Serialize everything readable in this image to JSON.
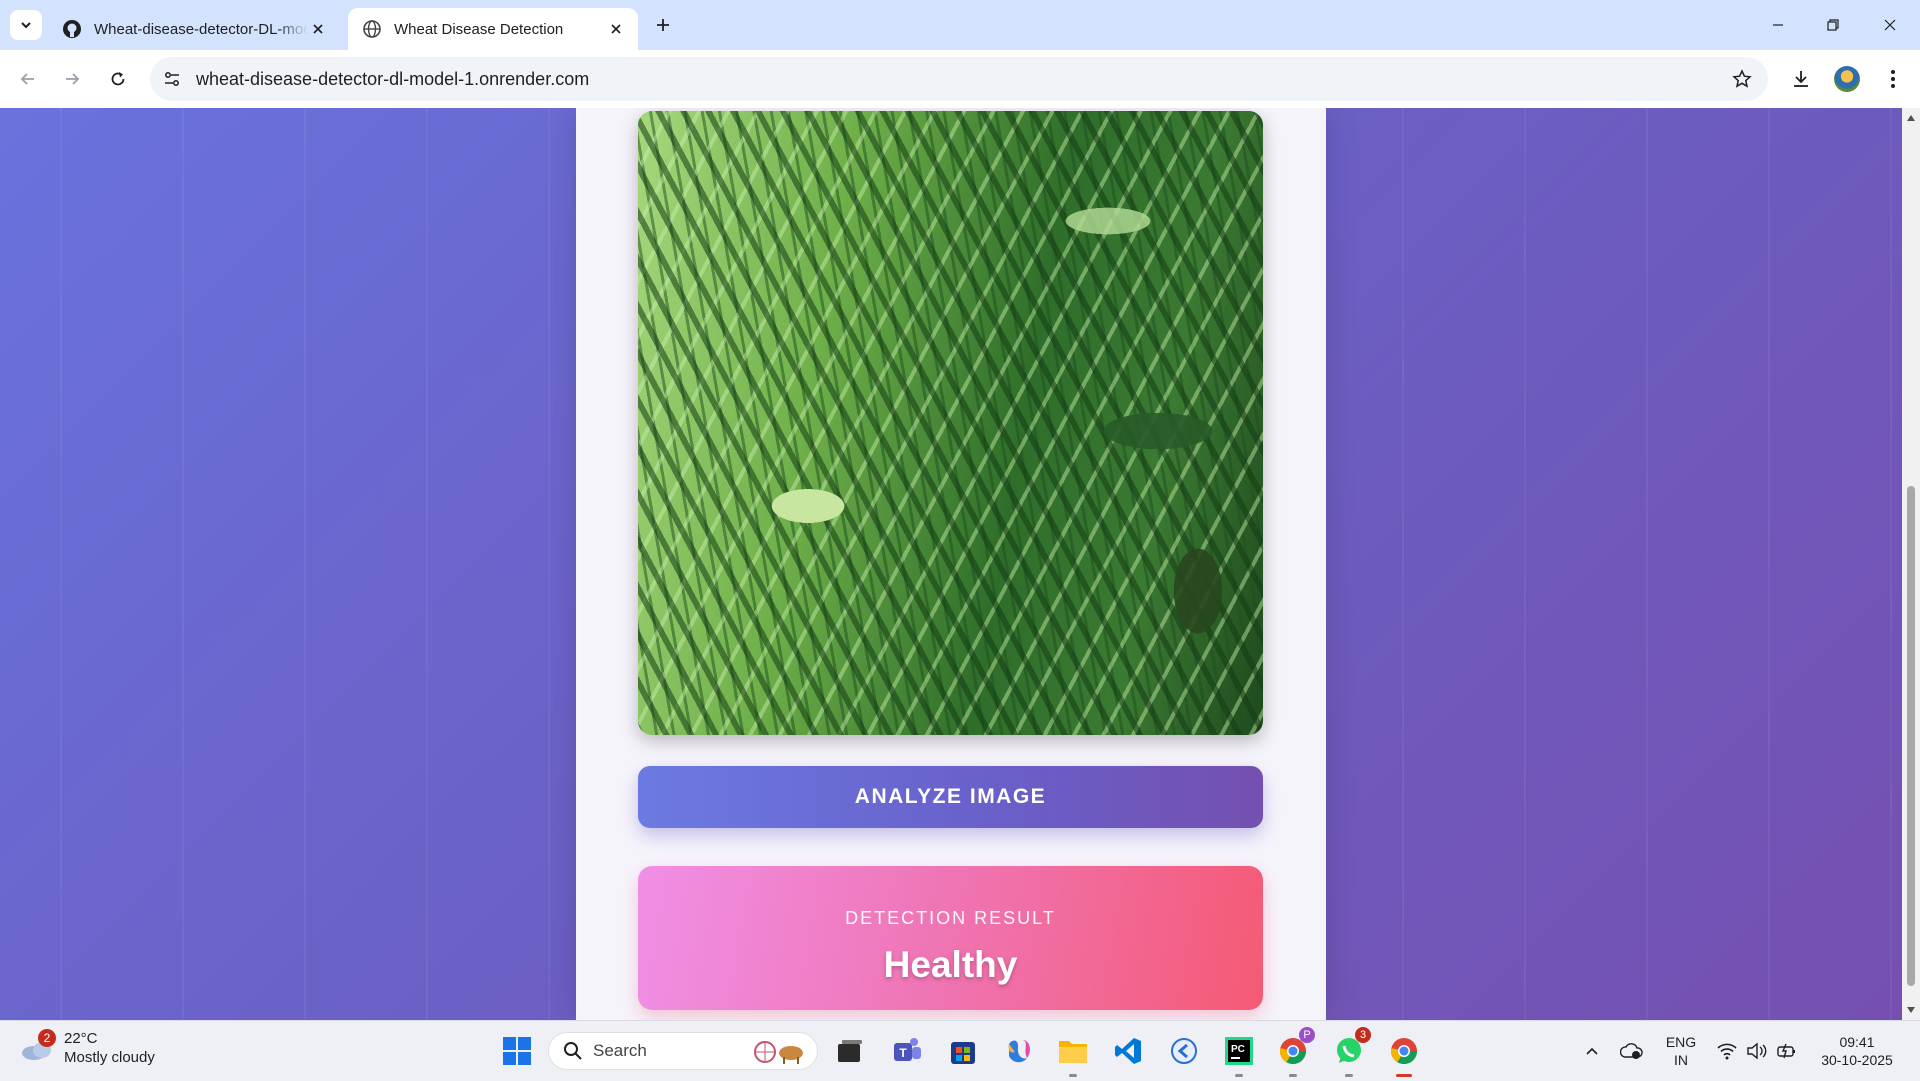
{
  "browser": {
    "tabs": [
      {
        "title": "Wheat-disease-detector-DL-model-1",
        "active": false
      },
      {
        "title": "Wheat Disease Detection",
        "active": true
      }
    ],
    "url": "wheat-disease-detector-dl-model-1.onrender.com"
  },
  "page": {
    "analyze_button": "ANALYZE IMAGE",
    "result_label": "DETECTION RESULT",
    "result_value": "Healthy"
  },
  "taskbar": {
    "weather": {
      "temp": "22°C",
      "condition": "Mostly cloudy",
      "badge": "2"
    },
    "search_placeholder": "Search",
    "whatsapp_badge": "3",
    "chrome_profile_badge": "P",
    "language": {
      "line1": "ENG",
      "line2": "IN"
    },
    "time": "09:41",
    "date": "30-10-2025"
  }
}
